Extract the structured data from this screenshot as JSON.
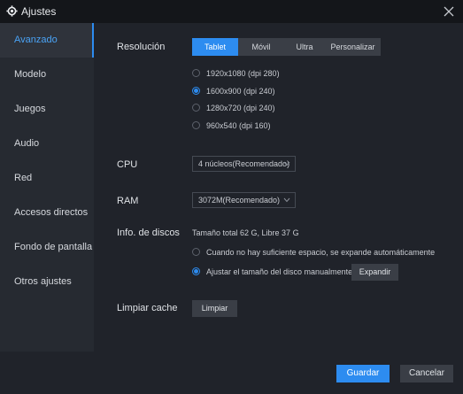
{
  "window": {
    "title": "Ajustes",
    "icons": {
      "app": "gear-icon",
      "close": "close-icon"
    }
  },
  "sidebar": {
    "items": [
      {
        "label": "Avanzado",
        "active": true
      },
      {
        "label": "Modelo"
      },
      {
        "label": "Juegos"
      },
      {
        "label": "Audio"
      },
      {
        "label": "Red"
      },
      {
        "label": "Accesos directos"
      },
      {
        "label": "Fondo de pantalla"
      },
      {
        "label": "Otros ajustes"
      }
    ]
  },
  "resolution": {
    "label": "Resolución",
    "tabs": [
      "Tablet",
      "Móvil",
      "Ultra",
      "Personalizar"
    ],
    "selected_tab": "Tablet",
    "options": [
      "1920x1080  (dpi 280)",
      "1600x900  (dpi 240)",
      "1280x720  (dpi 240)",
      "960x540  (dpi 160)"
    ],
    "selected_option": "1600x900  (dpi 240)"
  },
  "cpu": {
    "label": "CPU",
    "value": "4 núcleos(Recomendado)"
  },
  "ram": {
    "label": "RAM",
    "value": "3072M(Recomendado)"
  },
  "disk": {
    "label": "Info. de discos",
    "summary": "Tamaño total 62 G,  Libre 37 G",
    "options": [
      "Cuando no hay suficiente espacio, se expande automáticamente",
      "Ajustar el tamaño del disco manualmente"
    ],
    "selected_option": "Ajustar el tamaño del disco manualmente",
    "expand_button": "Expandir"
  },
  "cache": {
    "label": "Limpiar cache",
    "button": "Limpiar"
  },
  "footer": {
    "save": "Guardar",
    "cancel": "Cancelar"
  },
  "colors": {
    "accent": "#2d8cf0",
    "background": "#20232a",
    "sidebar": "#262a31",
    "titlebar": "#14161a"
  }
}
